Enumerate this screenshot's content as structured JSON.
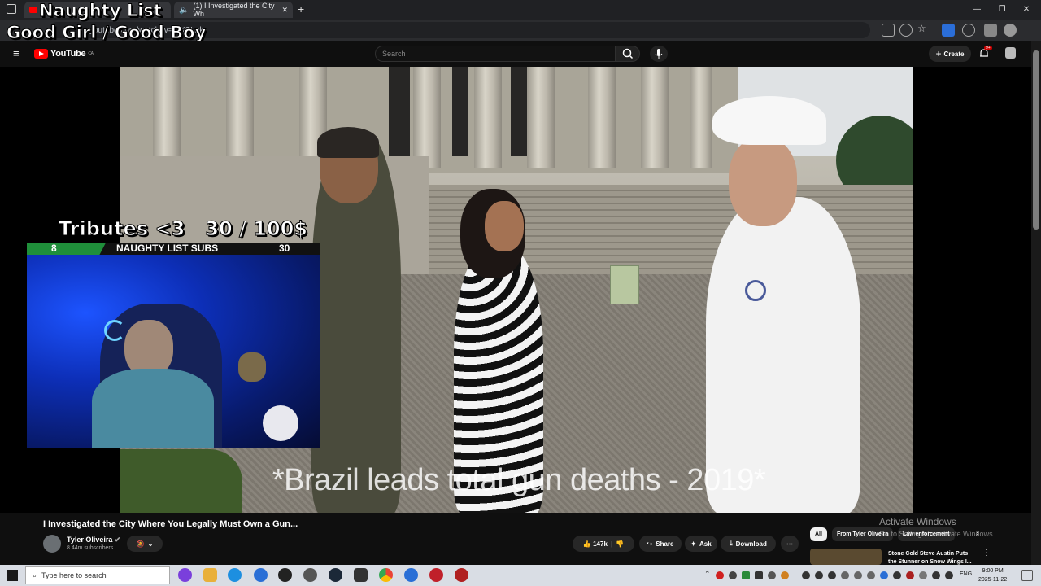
{
  "browser": {
    "tab_title": "(1) I Investigated the City Wh",
    "url": "youtube.com/watch?v=...XSLnk"
  },
  "overlay": {
    "title": "Naughty List",
    "subtitle": "Good Girl / Good Boy",
    "tributes": "Tributes <3   30 / 100$",
    "bar_left": "8",
    "bar_label": "NAUGHTY LIST SUBS",
    "bar_right": "30",
    "bar_fraction": 0.27
  },
  "youtube": {
    "logo": "YouTube",
    "logo_region": "CA",
    "search_placeholder": "Search",
    "create_label": "Create",
    "notif_count": "9+"
  },
  "video": {
    "caption": "*Brazil leads total gun deaths - 2019*",
    "title": "I Investigated the City Where You Legally Must Own a Gun...",
    "channel": "Tyler Oliveira",
    "subscribers": "8.44m subscribers",
    "like_count": "147k",
    "share_label": "Share",
    "ask_label": "Ask",
    "download_label": "Download"
  },
  "sidebar": {
    "chips": [
      "All",
      "From Tyler Oliveira",
      "Law enforcement"
    ],
    "rec_title": "Stone Cold Steve Austin Puts the Stunner on Snow Wings I..."
  },
  "watermark": {
    "line1": "Activate Windows",
    "line2": "Go to Settings to activate Windows."
  },
  "taskbar": {
    "search_placeholder": "Type here to search",
    "lang": "ENG",
    "time": "9:00 PM",
    "date": "2025-11-22"
  }
}
